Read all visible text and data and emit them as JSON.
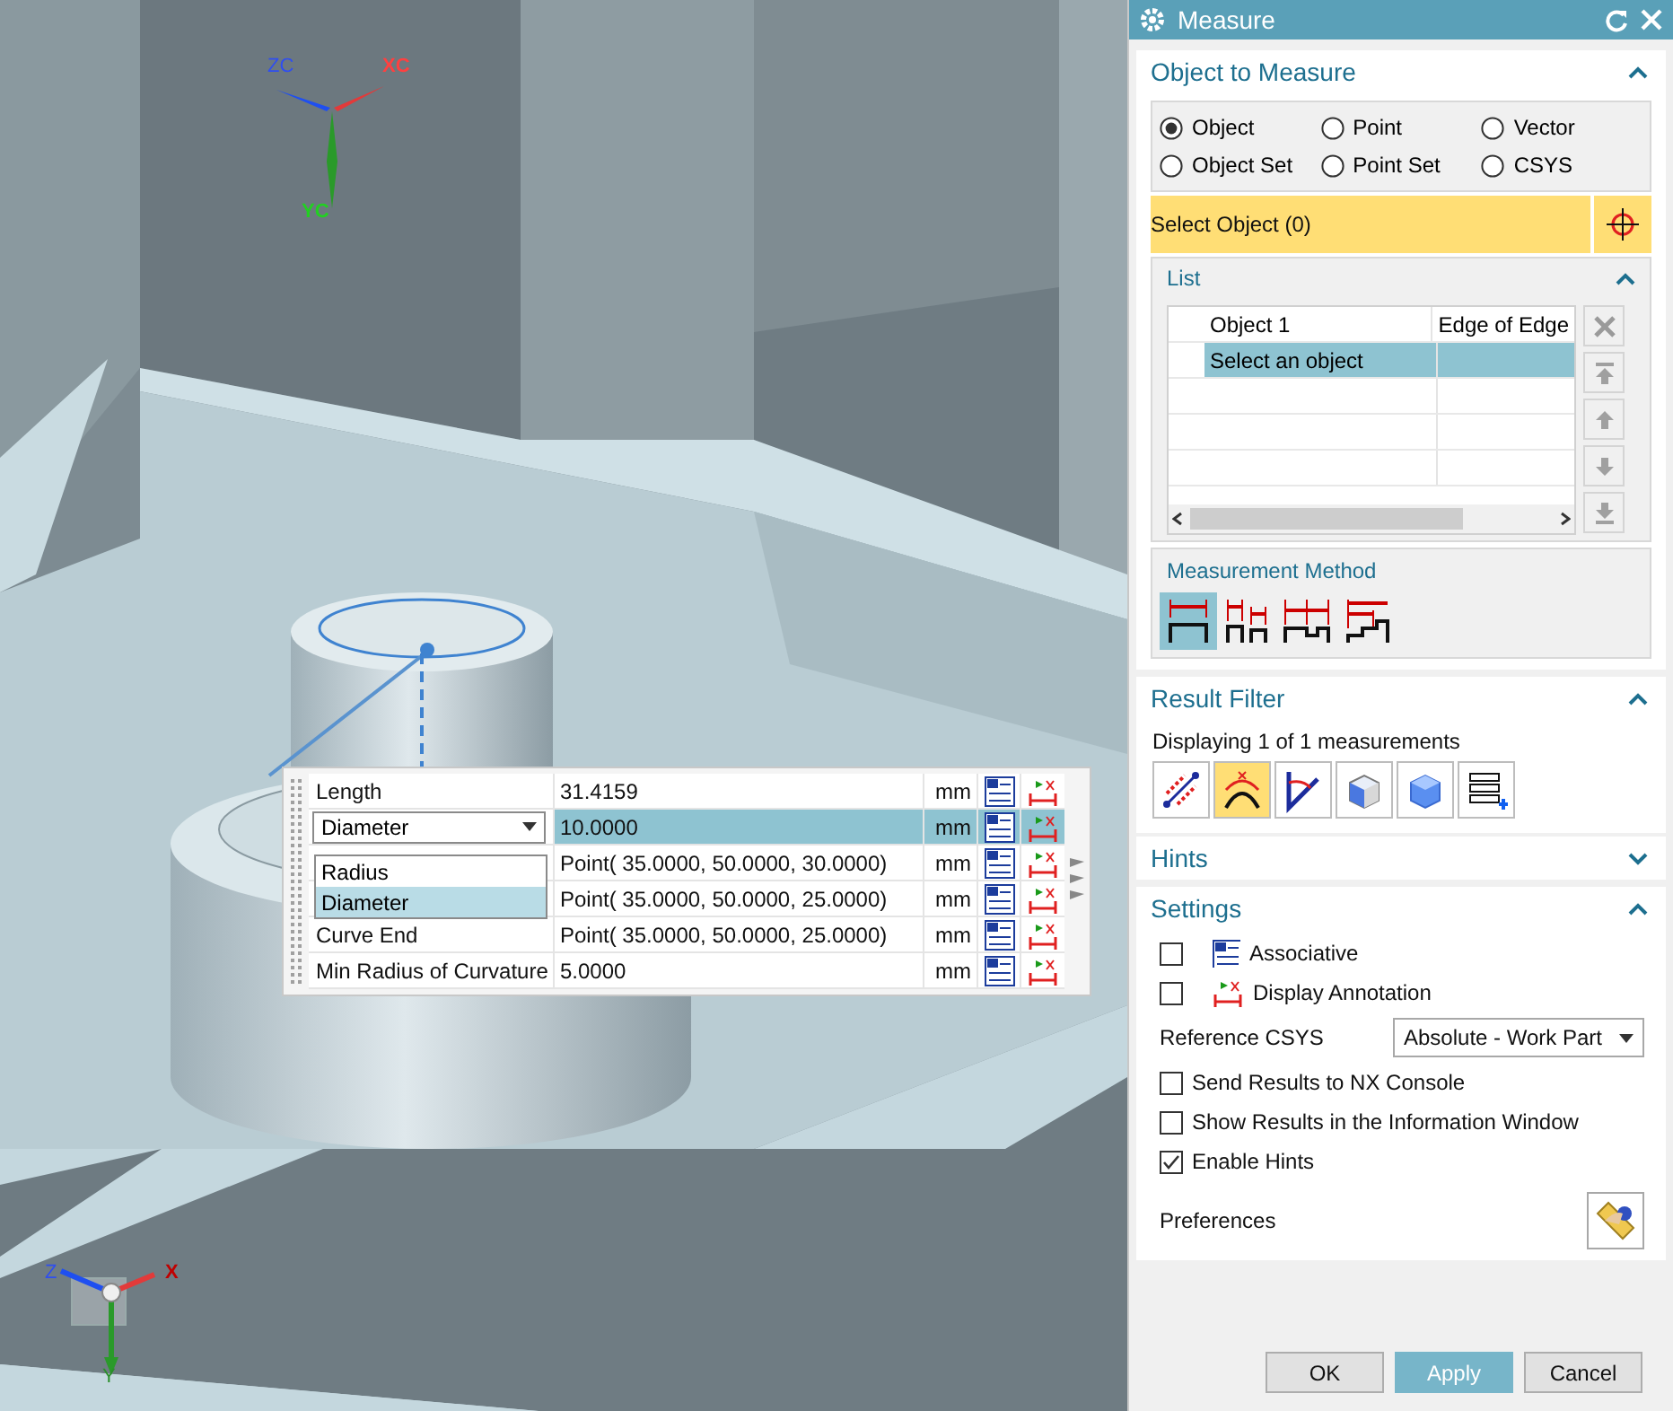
{
  "viewport": {
    "work_triad": [
      "ZC",
      "XC",
      "YC"
    ],
    "view_triad": [
      "Z",
      "X",
      "Y"
    ],
    "result_grid": {
      "rows": [
        {
          "kind": "text",
          "label": "Length",
          "value": "31.4159",
          "unit": "mm",
          "selected": false
        },
        {
          "kind": "dropdown",
          "label": "Diameter",
          "value": "10.0000",
          "unit": "mm",
          "selected": true
        },
        {
          "kind": "covered",
          "value": "Point( 35.0000, 50.0000, 30.0000)",
          "unit": "mm",
          "selected": false
        },
        {
          "kind": "covered",
          "value": "Point( 35.0000, 50.0000, 25.0000)",
          "unit": "mm",
          "selected": false
        },
        {
          "kind": "text",
          "label": "Curve End",
          "value": "Point( 35.0000, 50.0000, 25.0000)",
          "unit": "mm",
          "selected": false
        },
        {
          "kind": "text",
          "label": "Min Radius of Curvature",
          "value": "5.0000",
          "unit": "mm",
          "selected": false
        }
      ],
      "dropdown_options": [
        {
          "label": "Radius",
          "selected": false
        },
        {
          "label": "Diameter",
          "selected": true
        }
      ]
    }
  },
  "dialog": {
    "title": "Measure",
    "object_to_measure": {
      "title": "Object to Measure",
      "expanded": true,
      "types": [
        {
          "label": "Object",
          "selected": true
        },
        {
          "label": "Point",
          "selected": false
        },
        {
          "label": "Vector",
          "selected": false
        },
        {
          "label": "Object Set",
          "selected": false
        },
        {
          "label": "Point Set",
          "selected": false
        },
        {
          "label": "CSYS",
          "selected": false
        }
      ],
      "selection": "Select Object (0)",
      "list": {
        "title": "List",
        "expanded": true,
        "items": [
          {
            "label": "Object 1",
            "type": "Edge of Edge",
            "selected": false,
            "children": [
              {
                "label": "Select an object",
                "selected": true
              }
            ]
          }
        ]
      },
      "method": {
        "title": "Measurement Method",
        "options": [
          {
            "selected": true
          },
          {
            "selected": false
          },
          {
            "selected": false
          },
          {
            "selected": false
          }
        ]
      }
    },
    "result_filter": {
      "title": "Result Filter",
      "expanded": true,
      "summary": "Displaying 1 of 1 measurements",
      "filters": [
        {
          "selected": false
        },
        {
          "selected": true
        },
        {
          "selected": false
        },
        {
          "selected": false
        },
        {
          "selected": false
        },
        {
          "selected": false
        }
      ]
    },
    "hints": {
      "title": "Hints",
      "expanded": false
    },
    "settings": {
      "title": "Settings",
      "expanded": true,
      "options": [
        {
          "kind": "associative",
          "label": "Associative",
          "checked": false
        },
        {
          "kind": "annotation",
          "label": "Display Annotation",
          "checked": false
        },
        {
          "kind": "select",
          "label": "Reference CSYS",
          "value": "Absolute - Work Part"
        },
        {
          "kind": "plain",
          "label": "Send Results to NX Console",
          "checked": false
        },
        {
          "kind": "plain",
          "label": "Show Results in the Information Window",
          "checked": false
        },
        {
          "kind": "plain",
          "label": "Enable Hints",
          "checked": true
        }
      ],
      "preferences": "Preferences"
    },
    "buttons": [
      {
        "label": "OK",
        "kind": "normal"
      },
      {
        "label": "Apply",
        "kind": "primary"
      },
      {
        "label": "Cancel",
        "kind": "normal"
      }
    ]
  }
}
